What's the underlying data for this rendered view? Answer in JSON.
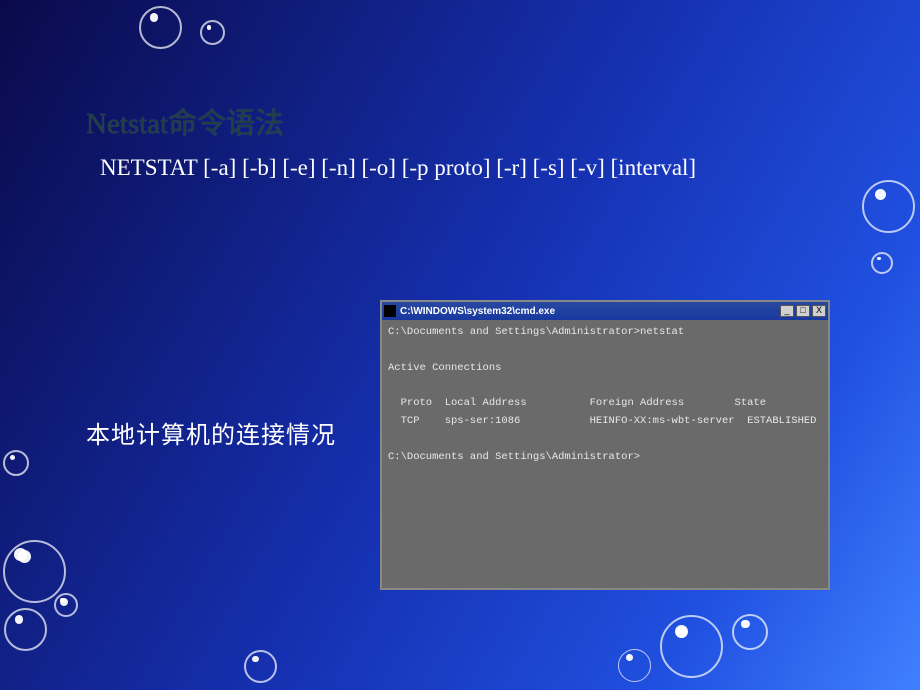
{
  "title": "Netstat命令语法",
  "syntax": "NETSTAT [-a] [-b] [-e] [-n] [-o] [-p proto] [-r] [-s] [-v] [interval]",
  "caption": "本地计算机的连接情况",
  "cmd": {
    "window_title": "C:\\WINDOWS\\system32\\cmd.exe",
    "btn_min": "_",
    "btn_max": "□",
    "btn_close": "X",
    "output": "C:\\Documents and Settings\\Administrator>netstat\n\nActive Connections\n\n  Proto  Local Address          Foreign Address        State\n  TCP    sps-ser:1086           HEINFO-XX:ms-wbt-server  ESTABLISHED\n\nC:\\Documents and Settings\\Administrator>"
  }
}
